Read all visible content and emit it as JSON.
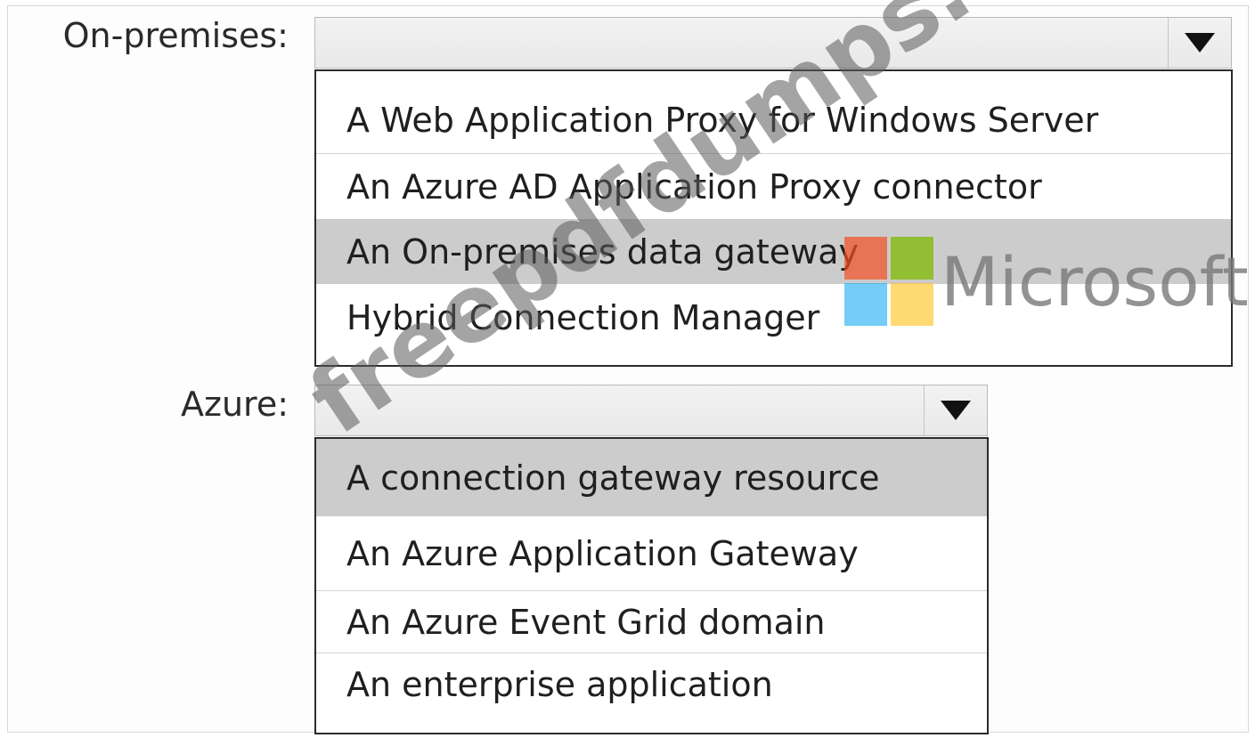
{
  "on_premises": {
    "label": "On-premises:",
    "selected": "",
    "options": [
      "A Web Application Proxy for Windows Server",
      "An Azure AD Application Proxy connector",
      "An On-premises data gateway",
      "Hybrid Connection Manager"
    ],
    "highlighted_index": 2
  },
  "azure": {
    "label": "Azure:",
    "selected": "",
    "options": [
      "A connection gateway resource",
      "An Azure Application Gateway",
      "An Azure Event Grid domain",
      "An enterprise application"
    ],
    "highlighted_index": 0
  },
  "watermark": {
    "text": "freepdfdumps.com",
    "brand_text": "Microsoft",
    "logo_colors": [
      "#f25022",
      "#7fba00",
      "#00a4ef",
      "#ffb900"
    ]
  },
  "colors": {
    "highlight": "#cccccc",
    "border": "#2b2b2b"
  }
}
